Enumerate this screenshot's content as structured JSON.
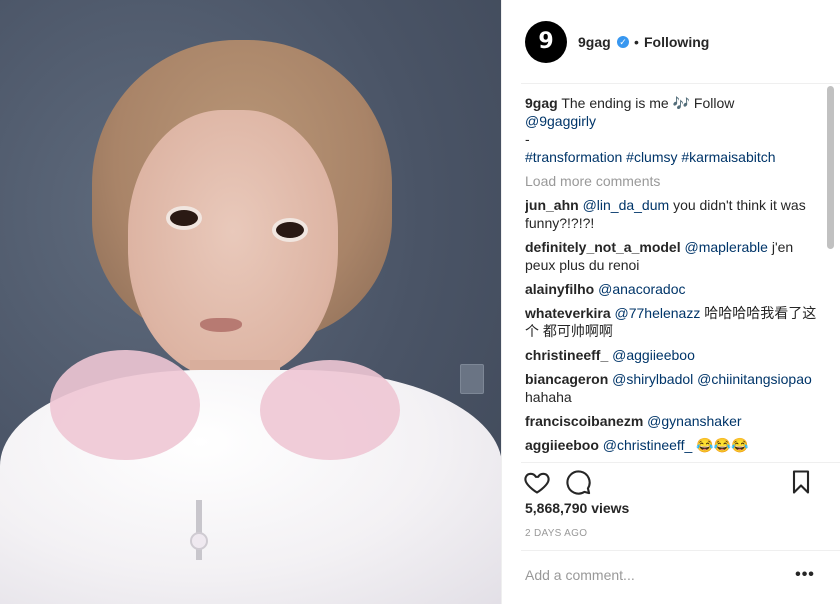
{
  "post": {
    "account": "9gag",
    "avatar_glyph": "9",
    "verified_icon": "check",
    "follow_dot": "•",
    "follow_status": "Following",
    "caption": {
      "username": "9gag",
      "text_1": "The ending is me 🎶 Follow",
      "mention": "@9gaggirly",
      "dash": "-",
      "hashtags": "#transformation #clumsy #karmaisabitch"
    },
    "load_more": "Load more comments",
    "comments": [
      {
        "user": "jun_ahn",
        "mention": "@lin_da_dum",
        "text": "you didn't think it was funny?!?!?!"
      },
      {
        "user": "definitely_not_a_model",
        "mention": "@maplerable",
        "text": "j'en peux plus du renoi"
      },
      {
        "user": "alainyfilho",
        "mention": "@anacoradoc",
        "text": ""
      },
      {
        "user": "whateverkira",
        "mention": "@77helenazz",
        "text": "哈哈哈哈我看了这个 都可帅啊啊"
      },
      {
        "user": "christineeff_",
        "mention": "@aggiieeboo",
        "text": ""
      },
      {
        "user": "biancageron",
        "mention": "@shirylbadol @chiinitangsiopao",
        "text": "hahaha"
      },
      {
        "user": "franciscoibanezm",
        "mention": "@gynanshaker",
        "text": ""
      },
      {
        "user": "aggiieeboo",
        "mention": "@christineeff_",
        "text": "😂😂😂"
      }
    ],
    "views_count": "5,868,790",
    "views_label": "views",
    "timestamp": "2 DAYS AGO",
    "comment_placeholder": "Add a comment...",
    "more_glyph": "•••"
  },
  "icons": {
    "like": "heart-icon",
    "comment": "comment-bubble-icon",
    "bookmark": "bookmark-icon",
    "more": "more-options-icon"
  },
  "colors": {
    "verified": "#3897f0",
    "link": "#003569",
    "muted": "#999999",
    "text": "#262626"
  }
}
